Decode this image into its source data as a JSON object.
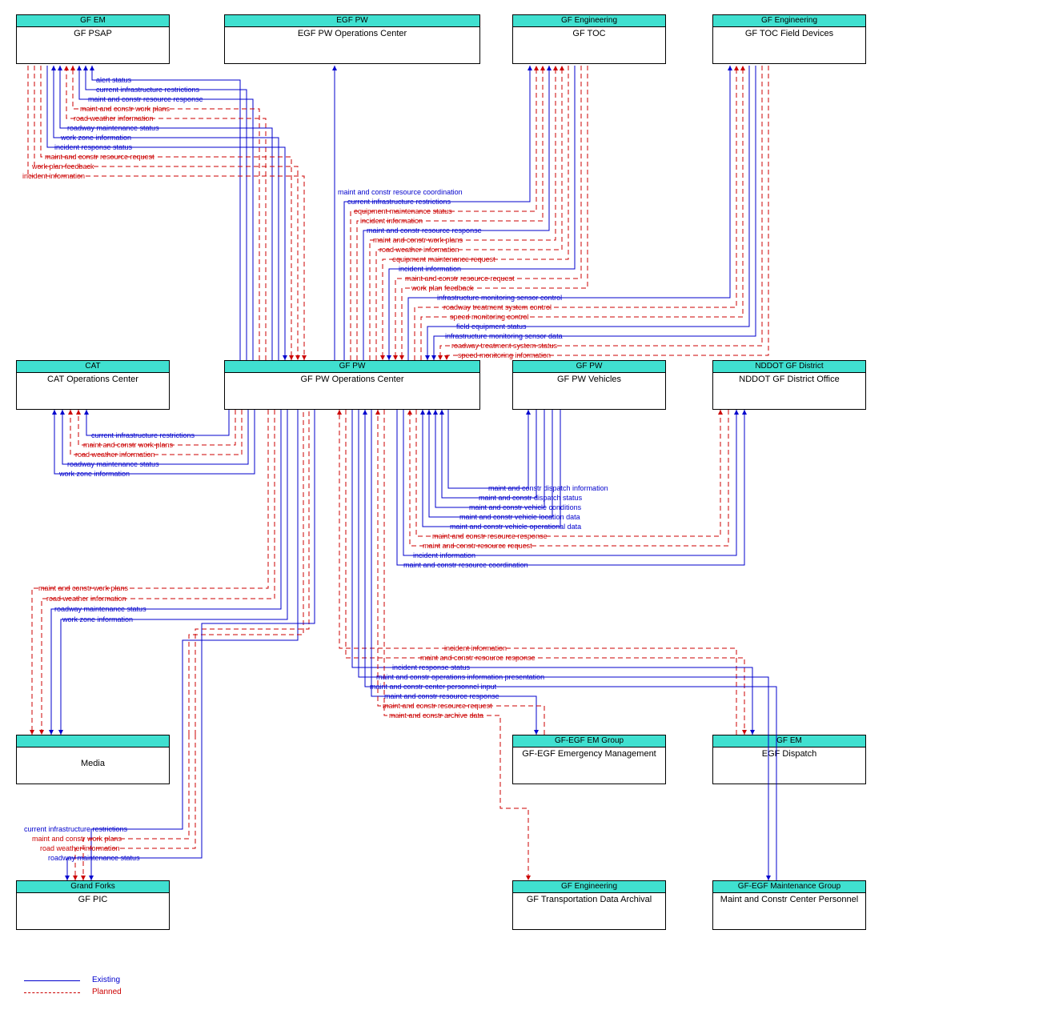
{
  "nodes": {
    "gf_psap": {
      "header": "GF EM",
      "body": "GF PSAP"
    },
    "egf_pw_ops": {
      "header": "EGF PW",
      "body": "EGF PW Operations Center"
    },
    "gf_toc": {
      "header": "GF Engineering",
      "body": "GF TOC"
    },
    "gf_toc_field": {
      "header": "GF Engineering",
      "body": "GF TOC Field Devices"
    },
    "cat_ops": {
      "header": "CAT",
      "body": "CAT Operations Center"
    },
    "gf_pw_ops": {
      "header": "GF PW",
      "body": "GF PW Operations Center"
    },
    "gf_pw_veh": {
      "header": "GF PW",
      "body": "GF PW Vehicles"
    },
    "nddot": {
      "header": "NDDOT GF District",
      "body": "NDDOT GF District Office"
    },
    "media": {
      "header": "",
      "body": "Media"
    },
    "gf_egf_em": {
      "header": "GF-EGF EM Group",
      "body": "GF-EGF Emergency Management"
    },
    "egf_dispatch": {
      "header": "GF EM",
      "body": "EGF Dispatch"
    },
    "gf_pic": {
      "header": "Grand Forks",
      "body": "GF PIC"
    },
    "gf_tda": {
      "header": "GF Engineering",
      "body": "GF Transportation Data Archival"
    },
    "mccp": {
      "header": "GF-EGF Maintenance Group",
      "body": "Maint and Constr Center Personnel"
    }
  },
  "flows": {
    "psap": {
      "f1": "alert status",
      "f2": "current infrastructure restrictions",
      "f3": "maint and constr resource response",
      "f4": "maint and constr work plans",
      "f5": "road weather information",
      "f6": "roadway maintenance status",
      "f7": "work zone information",
      "f8": "incident response status",
      "f9": "maint and constr resource request",
      "f10": "work plan feedback",
      "f11": "incident information"
    },
    "egf": {
      "f1": "maint and constr resource coordination"
    },
    "toc": {
      "f1": "current infrastructure restrictions",
      "f2": "equipment maintenance status",
      "f3": "incident information",
      "f4": "maint and constr resource response",
      "f5": "maint and constr work plans",
      "f6": "road weather information",
      "f7": "equipment maintenance request",
      "f8": "incident information",
      "f9": "maint and constr resource request",
      "f10": "work plan feedback"
    },
    "field": {
      "f1": "infrastructure monitoring sensor control",
      "f2": "roadway treatment system control",
      "f3": "speed monitoring control",
      "f4": "field equipment status",
      "f5": "infrastructure monitoring sensor data",
      "f6": "roadway treatment system status",
      "f7": "speed monitoring information"
    },
    "cat": {
      "f1": "current infrastructure restrictions",
      "f2": "maint and constr work plans",
      "f3": "road weather information",
      "f4": "roadway maintenance status",
      "f5": "work zone information"
    },
    "veh": {
      "f1": "maint and constr dispatch information",
      "f2": "maint and constr dispatch status",
      "f3": "maint and constr vehicle conditions",
      "f4": "maint and constr vehicle location data",
      "f5": "maint and constr vehicle operational data"
    },
    "nddot": {
      "f1": "maint and constr resource response",
      "f2": "maint and constr resource request",
      "f3": "incident information",
      "f4": "maint and constr resource coordination"
    },
    "media": {
      "f1": "maint and constr work plans",
      "f2": "road weather information",
      "f3": "roadway maintenance status",
      "f4": "work zone information"
    },
    "dispatch": {
      "f1": "incident information",
      "f2": "maint and constr resource response",
      "f3": "incident response status"
    },
    "mccp": {
      "f1": "maint and constr operations information presentation",
      "f2": "maint and constr center personnel input"
    },
    "em": {
      "f1": "maint and constr resource response",
      "f2": "maint and constr resource request"
    },
    "tda": {
      "f1": "maint and constr archive data"
    },
    "pic": {
      "f1": "current infrastructure restrictions",
      "f2": "maint and constr work plans",
      "f3": "road weather information",
      "f4": "roadway maintenance status"
    }
  },
  "legend": {
    "existing": "Existing",
    "planned": "Planned"
  }
}
